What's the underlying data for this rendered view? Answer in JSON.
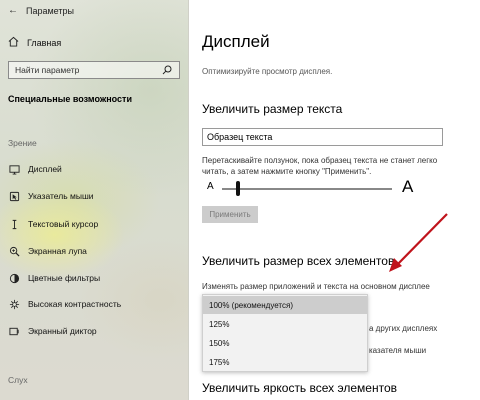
{
  "window": {
    "title": "Параметры"
  },
  "sidebar": {
    "home_label": "Главная",
    "search_placeholder": "Найти параметр",
    "header": "Специальные возможности",
    "section_vision": "Зрение",
    "items": [
      {
        "label": "Дисплей",
        "icon": "display-icon"
      },
      {
        "label": "Указатель мыши",
        "icon": "mouse-pointer-icon"
      },
      {
        "label": "Текстовый курсор",
        "icon": "text-cursor-icon"
      },
      {
        "label": "Экранная лупа",
        "icon": "magnifier-icon"
      },
      {
        "label": "Цветные фильтры",
        "icon": "color-filter-icon"
      },
      {
        "label": "Высокая контрастность",
        "icon": "contrast-icon"
      },
      {
        "label": "Экранный диктор",
        "icon": "narrator-icon"
      }
    ],
    "section_hearing": "Слух"
  },
  "main": {
    "title": "Дисплей",
    "subtitle": "Оптимизируйте просмотр дисплея.",
    "text_size": {
      "heading": "Увеличить размер текста",
      "sample_text": "Образец текста",
      "help_line1": "Перетаскивайте ползунок, пока образец текста не станет легко",
      "help_line2": "читать, а затем нажмите кнопку \"Применить\".",
      "small_a": "A",
      "big_a": "A",
      "slider_value": 0.08,
      "apply_label": "Применить"
    },
    "scale": {
      "heading": "Увеличить размер всех элементов",
      "description": "Изменять размер приложений и текста на основном дисплее",
      "behind_text_1": "а других дисплеях",
      "behind_text_2": "казателя мыши",
      "options": [
        "100% (рекомендуется)",
        "125%",
        "150%",
        "175%"
      ],
      "selected_index": 0
    },
    "brightness": {
      "heading": "Увеличить яркость всех элементов"
    }
  },
  "colors": {
    "annotation_arrow": "#c0141c",
    "selected_option": "#cdcdcd"
  }
}
